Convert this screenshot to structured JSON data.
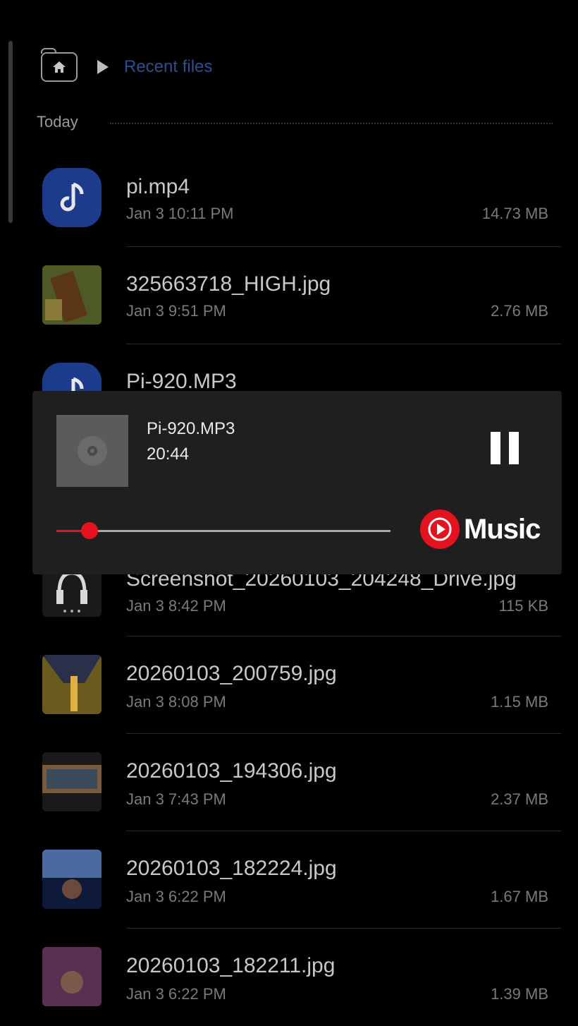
{
  "breadcrumb": {
    "label": "Recent files"
  },
  "section": {
    "title": "Today"
  },
  "files": [
    {
      "name": "pi.mp4",
      "meta": "Jan 3 10:11 PM",
      "size": "14.73 MB",
      "thumb": "music-icon"
    },
    {
      "name": "325663718_HIGH.jpg",
      "meta": "Jan 3 9:51 PM",
      "size": "2.76 MB",
      "thumb": "image"
    },
    {
      "name": "Pi-920.MP3",
      "meta": "",
      "size": "",
      "thumb": "music-icon"
    },
    {
      "name": "Screenshot_20260103_204248_Drive.jpg",
      "meta": "Jan 3 8:42 PM",
      "size": "115 KB",
      "thumb": "image"
    },
    {
      "name": "20260103_200759.jpg",
      "meta": "Jan 3 8:08 PM",
      "size": "1.15 MB",
      "thumb": "image"
    },
    {
      "name": "20260103_194306.jpg",
      "meta": "Jan 3 7:43 PM",
      "size": "2.37 MB",
      "thumb": "image"
    },
    {
      "name": "20260103_182224.jpg",
      "meta": "Jan 3 6:22 PM",
      "size": "1.67 MB",
      "thumb": "image"
    },
    {
      "name": "20260103_182211.jpg",
      "meta": "Jan 3 6:22 PM",
      "size": "1.39 MB",
      "thumb": "image"
    }
  ],
  "player": {
    "title": "Pi-920.MP3",
    "time": "20:44",
    "progress": 0.1,
    "brand": "Music",
    "accent": "#e5121f"
  }
}
